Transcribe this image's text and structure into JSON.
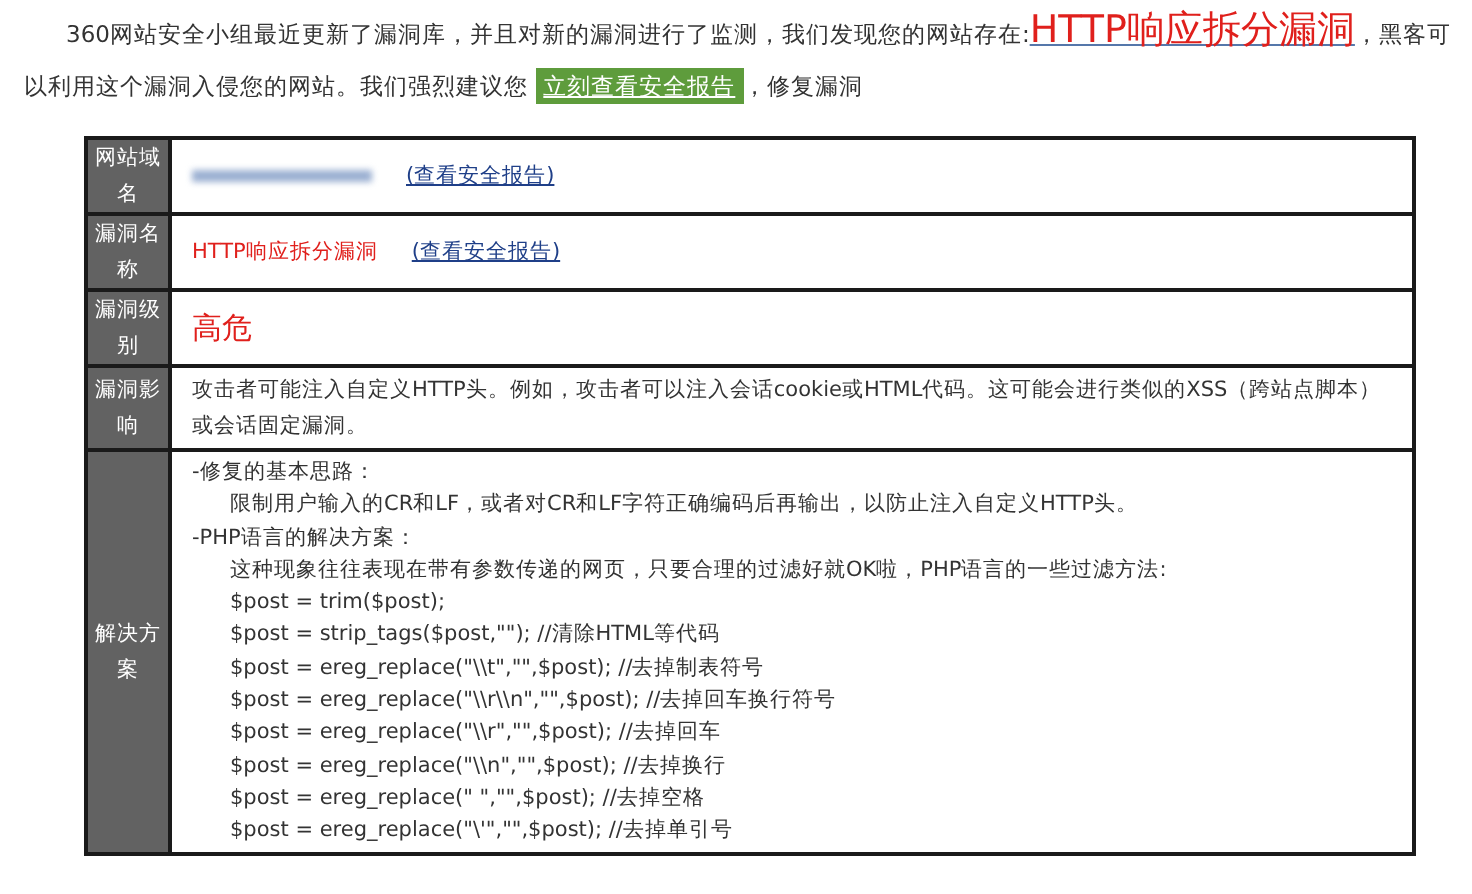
{
  "intro": {
    "text_before": "360网站安全小组最近更新了漏洞库，并且对新的漏洞进行了监测，我们发现您的网站存在:",
    "vuln_link": "HTTP响应拆分漏洞",
    "text_middle": "，黑客可以利用这个漏洞入侵您的网站。我们强烈建议您",
    "button": "立刻查看安全报告",
    "text_end": "，修复漏洞"
  },
  "rows": [
    {
      "label": "网站域名",
      "kind": "domain",
      "link": "(查看安全报告)"
    },
    {
      "label": "漏洞名称",
      "kind": "name",
      "value": "HTTP响应拆分漏洞",
      "link": "(查看安全报告)"
    },
    {
      "label": "漏洞级别",
      "kind": "level",
      "value": "高危"
    },
    {
      "label": "漏洞影响",
      "kind": "text",
      "value": "攻击者可能注入自定义HTTP头。例如，攻击者可以注入会话cookie或HTML代码。这可能会进行类似的XSS（跨站点脚本）或会话固定漏洞。"
    },
    {
      "label": "解决方案",
      "kind": "outline",
      "lines": [
        {
          "text": "-修复的基本思路：",
          "children": [
            {
              "text": "限制用户输入的CR和LF，或者对CR和LF字符正确编码后再输出，以防止注入自定义HTTP头。"
            }
          ]
        },
        {
          "text": "-PHP语言的解决方案：",
          "children": [
            {
              "text": "这种现象往往表现在带有参数传递的网页，只要合理的过滤好就OK啦，PHP语言的一些过滤方法:"
            },
            {
              "text": "$post = trim($post);"
            },
            {
              "text": "$post = strip_tags($post,\"\"); //清除HTML等代码"
            },
            {
              "text": "$post = ereg_replace(\"\\\\t\",\"\",$post); //去掉制表符号"
            },
            {
              "text": "$post = ereg_replace(\"\\\\r\\\\n\",\"\",$post); //去掉回车换行符号"
            },
            {
              "text": "$post = ereg_replace(\"\\\\r\",\"\",$post); //去掉回车"
            },
            {
              "text": "$post = ereg_replace(\"\\\\n\",\"\",$post); //去掉换行"
            },
            {
              "text": "$post = ereg_replace(\" \",\"\",$post); //去掉空格"
            },
            {
              "text": "$post = ereg_replace(\"\\'\",\"\",$post); //去掉单引号"
            }
          ]
        }
      ]
    }
  ]
}
